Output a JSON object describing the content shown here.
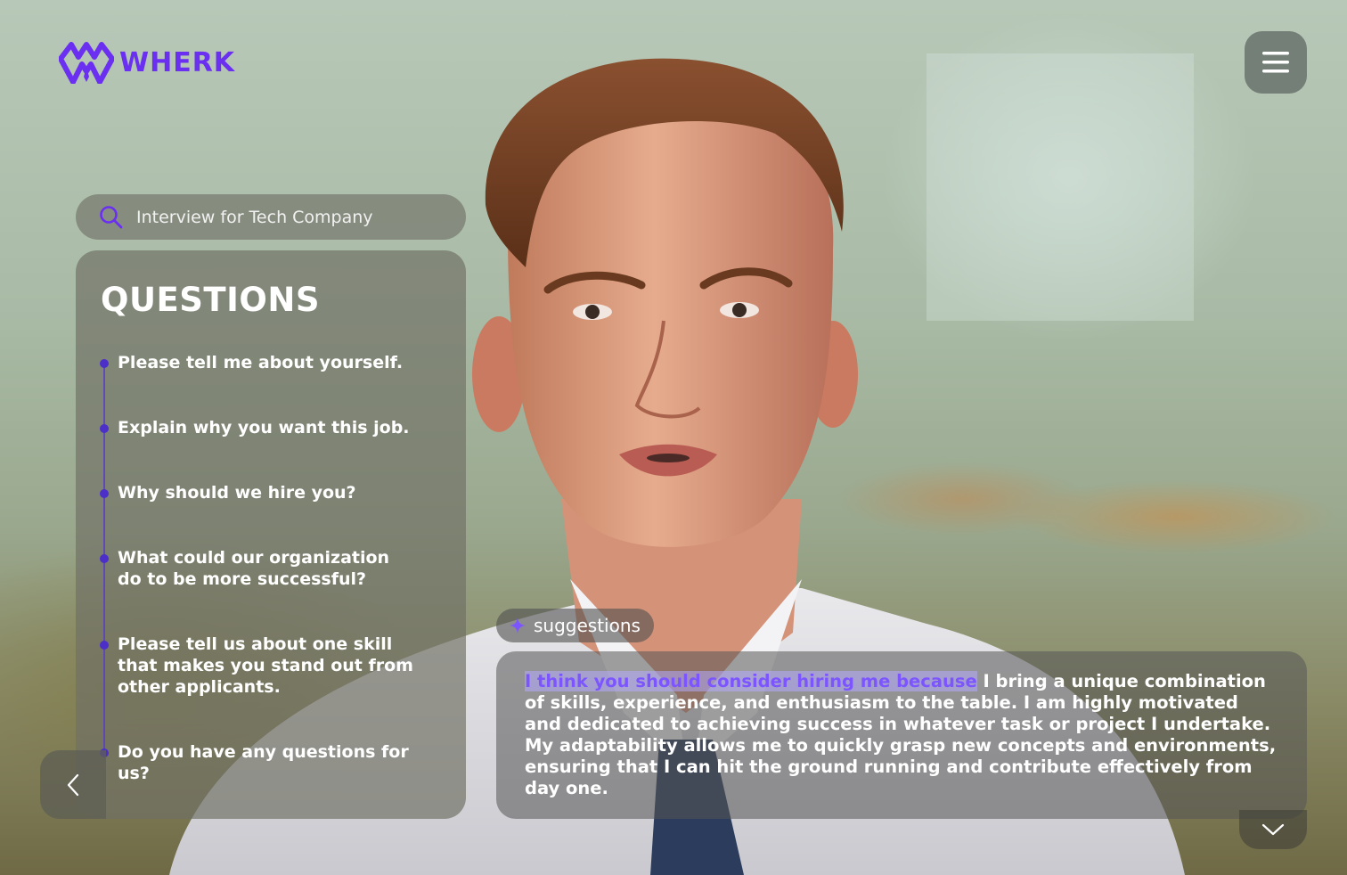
{
  "app": {
    "logo_text": "WHERK"
  },
  "header": {
    "menu_icon": "hamburger-menu-icon"
  },
  "search": {
    "value": "Interview for Tech Company",
    "icon": "search-icon"
  },
  "questions": {
    "title": "QUESTIONS",
    "items": [
      {
        "label": "Please tell me about yourself."
      },
      {
        "label": "Explain why you want this job."
      },
      {
        "label": "Why should we hire you?"
      },
      {
        "label": "What could our organization do to be more successful?"
      },
      {
        "label": "Please tell us about one skill that makes you stand out from other applicants."
      },
      {
        "label": "Do you have any questions for us?"
      }
    ],
    "back_icon": "chevron-left-icon"
  },
  "suggestions": {
    "label": "suggestions",
    "icon": "sparkle-icon",
    "highlighted": "I think you should consider hiring me because",
    "rest": " I bring a unique combination of skills, experience, and enthusiasm to the table. I am highly motivated and dedicated to achieving success in whatever task or project I undertake. My adaptability allows me to quickly grasp new concepts and environments, ensuring that I can hit the ground running and contribute effectively from day one.",
    "expand_icon": "chevron-down-icon"
  },
  "colors": {
    "brand": "#6a2ff0",
    "highlight": "#7c55ff",
    "timeline": "#4b2fc8"
  }
}
